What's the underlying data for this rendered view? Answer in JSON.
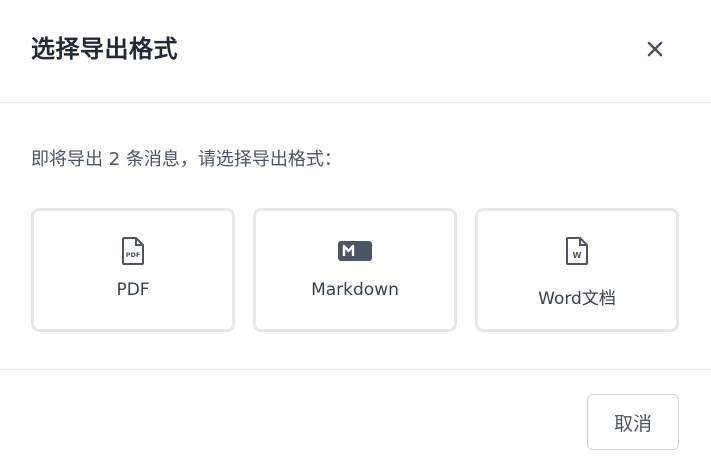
{
  "dialog": {
    "title": "选择导出格式",
    "close_icon": "close-icon",
    "message": "即将导出 2 条消息，请选择导出格式：",
    "options": [
      {
        "label": "PDF",
        "icon": "pdf-file-icon"
      },
      {
        "label": "Markdown",
        "icon": "markdown-icon"
      },
      {
        "label": "Word文档",
        "icon": "word-file-icon"
      }
    ],
    "cancel_label": "取消"
  },
  "colors": {
    "title": "#1f2937",
    "text": "#4b5563",
    "icon": "#4b5563",
    "border": "#e5e7eb",
    "divider": "#e5e7eb"
  }
}
